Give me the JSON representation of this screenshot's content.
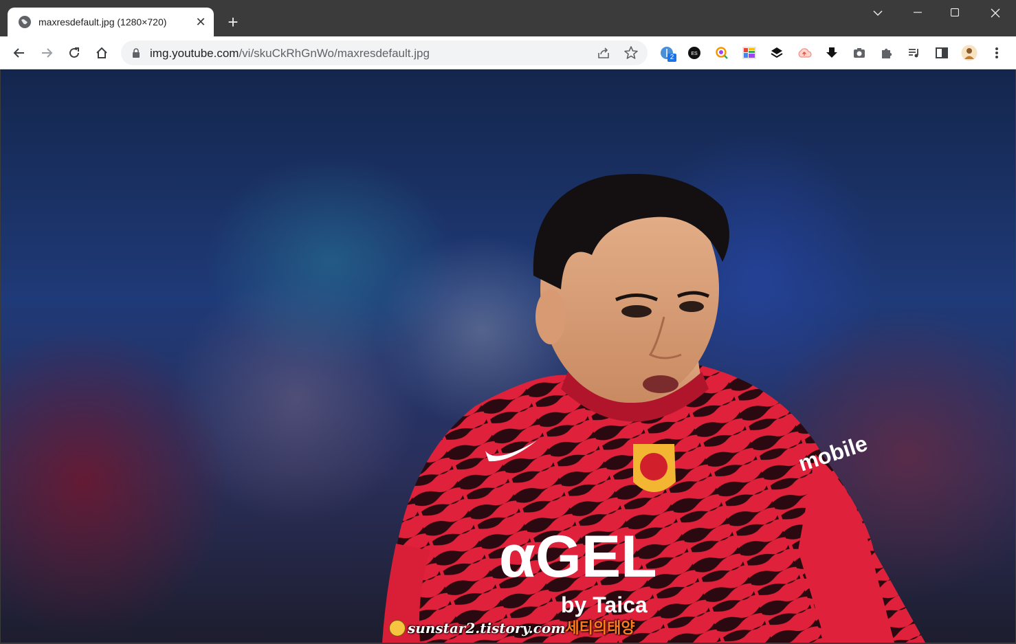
{
  "tab": {
    "title": "maxresdefault.jpg (1280×720)",
    "close_icon": "close-icon",
    "favicon": "globe-icon"
  },
  "new_tab_icon": "plus-icon",
  "window_controls": [
    "chevron-down-icon",
    "minimize-icon",
    "maximize-icon",
    "close-icon"
  ],
  "toolbar": {
    "nav_icons": [
      "back-arrow-icon",
      "forward-arrow-icon",
      "reload-icon",
      "home-icon"
    ],
    "url": {
      "host": "img.youtube.com",
      "path": "/vi/skuCkRhGnWo/maxresdefault.jpg"
    },
    "extensions_badge": "2",
    "extension_es_label": "ES"
  },
  "content": {
    "jersey_sponsor": "αGEL",
    "jersey_sponsor_sub": "by Taica",
    "sleeve_sponsor": "mobile",
    "watermark_en": "sunstar2.tistory.com",
    "watermark_kr": "세티의태양"
  },
  "colors": {
    "tabstrip": "#3b3b3b",
    "toolbar": "#ffffff",
    "omnibox": "#f1f3f4",
    "jersey_red": "#e0213b",
    "watermark_orange": "#ff7a1a"
  }
}
